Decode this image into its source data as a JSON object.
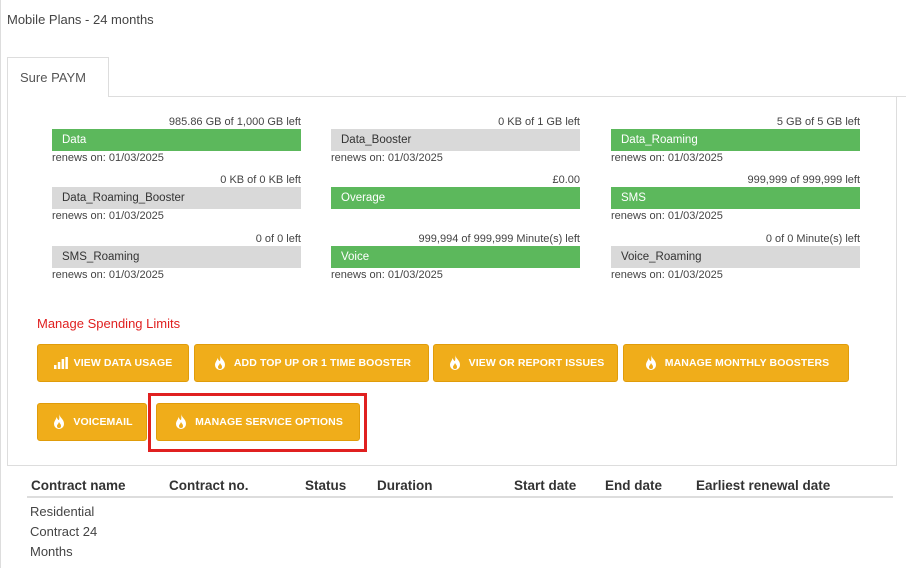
{
  "page": {
    "title": "Mobile Plans - 24 months"
  },
  "tab": {
    "label": "Sure PAYM"
  },
  "meters": [
    {
      "name": "Data",
      "left": "985.86 GB of 1,000 GB left",
      "renews": "renews on: 01/03/2025",
      "status": "green"
    },
    {
      "name": "Data_Booster",
      "left": "0 KB of 1 GB left",
      "renews": "renews on: 01/03/2025",
      "status": "gray"
    },
    {
      "name": "Data_Roaming",
      "left": "5 GB of 5 GB left",
      "renews": "renews on: 01/03/2025",
      "status": "green"
    },
    {
      "name": "Data_Roaming_Booster",
      "left": "0 KB of 0 KB left",
      "renews": "renews on: 01/03/2025",
      "status": "gray"
    },
    {
      "name": "Overage",
      "left": "£0.00",
      "renews": "",
      "status": "green"
    },
    {
      "name": "SMS",
      "left": "999,999 of 999,999 left",
      "renews": "renews on: 01/03/2025",
      "status": "green"
    },
    {
      "name": "SMS_Roaming",
      "left": "0 of 0 left",
      "renews": "renews on: 01/03/2025",
      "status": "gray"
    },
    {
      "name": "Voice",
      "left": "999,994 of 999,999 Minute(s) left",
      "renews": "renews on: 01/03/2025",
      "status": "green"
    },
    {
      "name": "Voice_Roaming",
      "left": "0 of 0 Minute(s) left",
      "renews": "renews on: 01/03/2025",
      "status": "gray"
    }
  ],
  "spending": {
    "label": "Manage Spending Limits"
  },
  "buttons": {
    "view_data_usage": "VIEW DATA USAGE",
    "add_top_up": "ADD TOP UP OR 1 TIME BOOSTER",
    "view_report_issues": "VIEW OR REPORT ISSUES",
    "manage_monthly_boosters": "MANAGE MONTHLY BOOSTERS",
    "voicemail": "VOICEMAIL",
    "manage_service_options": "MANAGE SERVICE OPTIONS"
  },
  "icons": {
    "usage": "bar-chart-icon",
    "flame": "flame-icon"
  },
  "contracts": {
    "headers": [
      "Contract name",
      "Contract no.",
      "Status",
      "Duration",
      "Start date",
      "End date",
      "Earliest renewal date"
    ],
    "rows": [
      {
        "name": "Residential Contract 24 Months",
        "number": "",
        "status": "",
        "duration": "",
        "start": "",
        "end": "",
        "renewal": ""
      }
    ]
  },
  "colors": {
    "accent": "#f0ad1a",
    "green": "#5cb85c",
    "gray": "#d9d9d9",
    "highlight": "#e02020"
  }
}
